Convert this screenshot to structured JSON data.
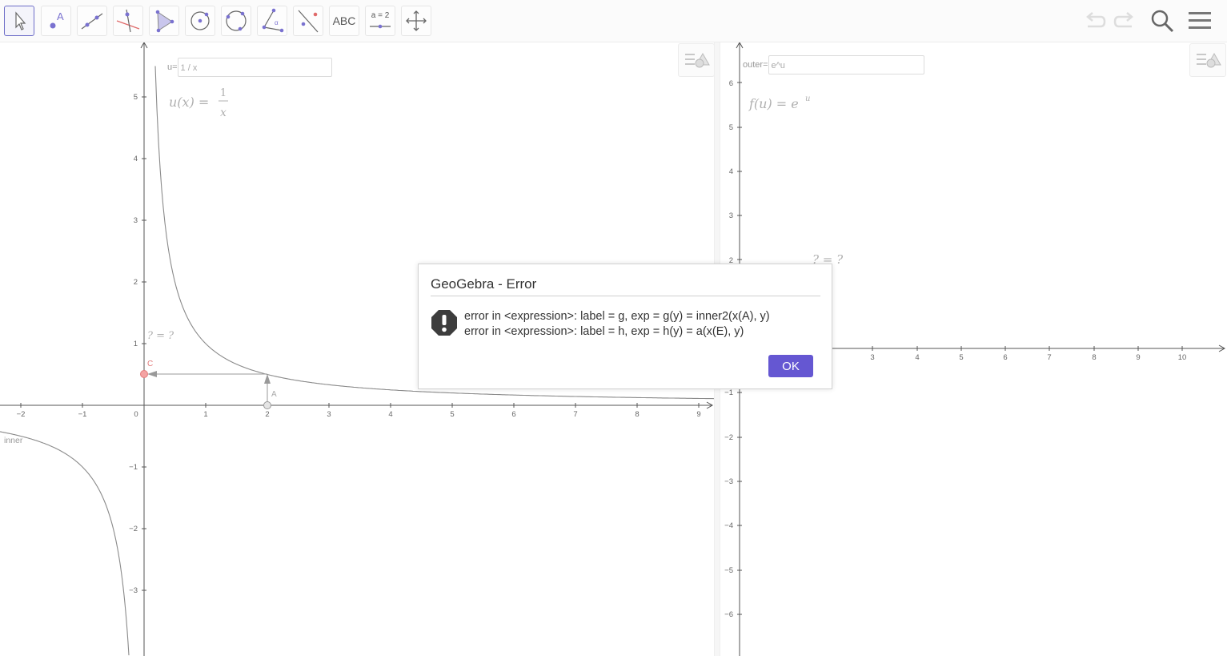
{
  "app": {
    "name": "GeoGebra"
  },
  "toolbar": {
    "tools": [
      {
        "id": "move",
        "icon": "move-arrow-icon"
      },
      {
        "id": "point",
        "icon": "point-icon",
        "label": "A"
      },
      {
        "id": "line",
        "icon": "line-through-points-icon"
      },
      {
        "id": "perpendicular",
        "icon": "perpendicular-line-icon"
      },
      {
        "id": "polygon",
        "icon": "polygon-icon"
      },
      {
        "id": "circle",
        "icon": "circle-center-point-icon"
      },
      {
        "id": "circle3",
        "icon": "circle-three-points-icon"
      },
      {
        "id": "angle",
        "icon": "angle-icon",
        "label": "α"
      },
      {
        "id": "reflect",
        "icon": "reflect-about-line-icon"
      },
      {
        "id": "text",
        "icon": "text-icon",
        "label": "ABC"
      },
      {
        "id": "slider",
        "icon": "slider-icon",
        "label": "a = 2"
      },
      {
        "id": "move-graphics",
        "icon": "move-graphics-view-icon"
      }
    ],
    "right": [
      "undo-icon",
      "redo-icon",
      "search-icon",
      "menu-icon"
    ]
  },
  "left_view": {
    "input_label": "u=",
    "input_value": "1 / x",
    "formula_lhs": "u(x) =",
    "formula_num": "1",
    "formula_den": "x",
    "placeholder_eq": "? = ?",
    "point_c_label": "C",
    "point_a_label": "A",
    "curve_label": "inner",
    "x_ticks": [
      "−2",
      "−1",
      "0",
      "1",
      "2",
      "3",
      "4",
      "5",
      "6",
      "7",
      "8",
      "9"
    ],
    "y_ticks": [
      "5",
      "4",
      "3",
      "2",
      "1",
      "−1",
      "−2",
      "−3"
    ]
  },
  "right_view": {
    "input_label": "outer=",
    "input_value": "e^u",
    "formula": "f(u) = e",
    "formula_sup": "u",
    "placeholder_eq": "? = ?",
    "x_ticks": [
      "3",
      "4",
      "5",
      "6",
      "7",
      "8",
      "9",
      "10"
    ],
    "y_ticks": [
      "6",
      "5",
      "4",
      "3",
      "2",
      "−1",
      "−2",
      "−3",
      "−4",
      "−5",
      "−6"
    ]
  },
  "dialog": {
    "title": "GeoGebra - Error",
    "line1": "error in <expression>: label = g, exp = g(y) = inner2(x(A), y)",
    "line2": "error in <expression>: label = h, exp = h(y) = a(x(E), y)",
    "ok_label": "OK"
  },
  "colors": {
    "accent": "#6557d2",
    "curve": "#8a8a8a",
    "point_c": "#f08a8a",
    "tool_icon": "#7a72d0"
  }
}
